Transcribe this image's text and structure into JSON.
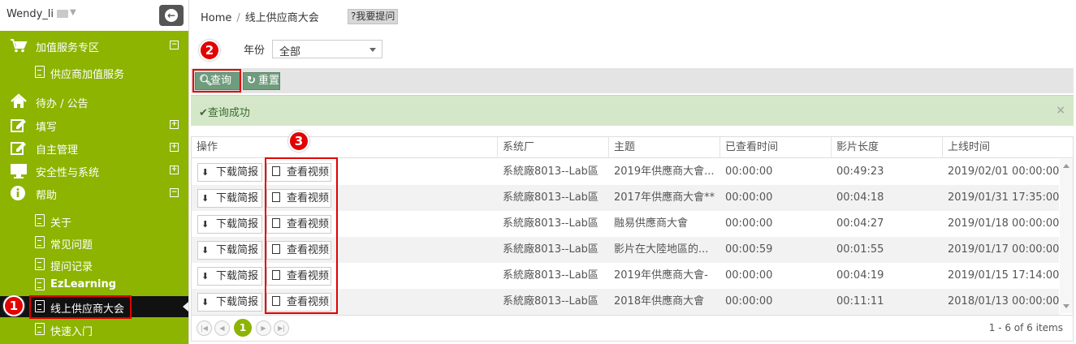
{
  "sidebar": {
    "user_name": "Wendy_li",
    "sections": [
      {
        "label": "加值服务专区",
        "icon": "cart-icon",
        "toggle": "⊟"
      },
      {
        "label": "待办 / 公告",
        "icon": "home-icon"
      },
      {
        "label": "填写",
        "icon": "edit-icon",
        "toggle": "⊞"
      },
      {
        "label": "自主管理",
        "icon": "edit-icon",
        "toggle": "⊞"
      },
      {
        "label": "安全性与系统",
        "icon": "desktop-icon",
        "toggle": "⊞"
      },
      {
        "label": "帮助",
        "icon": "info-icon",
        "toggle": "⊟"
      }
    ],
    "sub_items": {
      "value_added": "供应商加值服务",
      "about": "关于",
      "faq": "常见问题",
      "question_log": "提问记录",
      "ezlearning": "EzLearning",
      "online_conference": "线上供应商大会",
      "quick_start": "快速入门"
    }
  },
  "breadcrumb": {
    "home": "Home",
    "sep": "/",
    "current": "线上供应商大会"
  },
  "ask_button": "?我要提问",
  "filter": {
    "year_label": "年份",
    "year_value": "全部"
  },
  "toolbar": {
    "query_label": "查询",
    "reset_label": "重置"
  },
  "message": {
    "text": "✔查询成功",
    "close": "×"
  },
  "annotations": {
    "badge1": "1",
    "badge2": "2",
    "badge3": "3"
  },
  "grid": {
    "columns": [
      "操作",
      "系统厂",
      "主题",
      "已查看时间",
      "影片长度",
      "上线时间"
    ],
    "download_label": "下载简报",
    "view_label": "查看视频",
    "rows": [
      {
        "vendor": "系統廠8013--Lab區",
        "topic": "2019年供應商大會...",
        "viewed": "00:00:00",
        "length": "00:49:23",
        "online": "2019/02/01 00:00:00"
      },
      {
        "vendor": "系統廠8013--Lab區",
        "topic": "2017年供應商大會**",
        "viewed": "00:00:00",
        "length": "00:04:18",
        "online": "2019/01/31 17:35:00"
      },
      {
        "vendor": "系統廠8013--Lab區",
        "topic": "融易供應商大會",
        "viewed": "00:00:00",
        "length": "00:04:27",
        "online": "2019/01/18 00:00:00"
      },
      {
        "vendor": "系統廠8013--Lab區",
        "topic": "影片在大陸地區的...",
        "viewed": "00:00:59",
        "length": "00:01:55",
        "online": "2019/01/17 00:00:00"
      },
      {
        "vendor": "系統廠8013--Lab區",
        "topic": "2019年供應商大會-",
        "viewed": "00:00:00",
        "length": "00:04:19",
        "online": "2019/01/15 17:14:00"
      },
      {
        "vendor": "系統廠8013--Lab區",
        "topic": "2018年供應商大會",
        "viewed": "00:00:00",
        "length": "00:11:11",
        "online": "2018/01/13 00:00:00"
      }
    ],
    "pager": {
      "current": "1",
      "info": "1 - 6 of 6 items"
    }
  }
}
